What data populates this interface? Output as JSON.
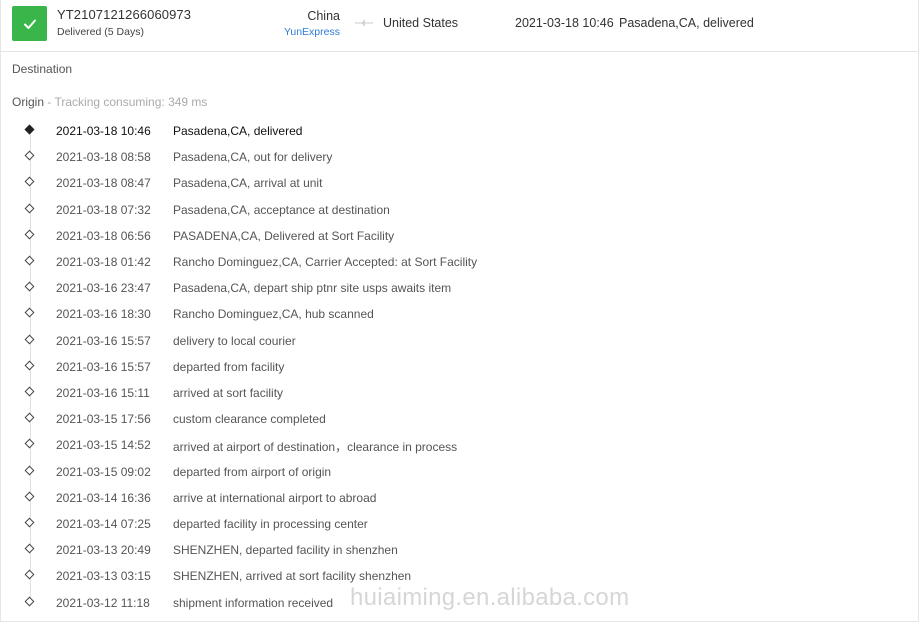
{
  "header": {
    "tracking_number": "YT2107121266060973",
    "status": "Delivered (5 Days)",
    "origin_country": "China",
    "carrier": "YunExpress",
    "destination_country": "United States",
    "latest_time": "2021-03-18 10:46",
    "latest_event": "Pasadena,CA, delivered",
    "status_color": "#39b54a",
    "carrier_color": "#2f7ed8",
    "status_icon": "checkmark-icon",
    "route_icon": "plane-icon"
  },
  "sections": {
    "destination_label": "Destination",
    "origin_label": "Origin",
    "origin_separator": " - ",
    "tracking_consuming": "Tracking consuming: 349 ms"
  },
  "events": [
    {
      "time": "2021-03-18 10:46",
      "desc": "Pasadena,CA, delivered"
    },
    {
      "time": "2021-03-18 08:58",
      "desc": "Pasadena,CA, out for delivery"
    },
    {
      "time": "2021-03-18 08:47",
      "desc": "Pasadena,CA, arrival at unit"
    },
    {
      "time": "2021-03-18 07:32",
      "desc": "Pasadena,CA, acceptance at destination"
    },
    {
      "time": "2021-03-18 06:56",
      "desc": "PASADENA,CA, Delivered at Sort Facility"
    },
    {
      "time": "2021-03-18 01:42",
      "desc": "Rancho Dominguez,CA, Carrier Accepted: at Sort Facility"
    },
    {
      "time": "2021-03-16 23:47",
      "desc": "Pasadena,CA, depart ship ptnr site usps awaits item"
    },
    {
      "time": "2021-03-16 18:30",
      "desc": "Rancho Dominguez,CA, hub scanned"
    },
    {
      "time": "2021-03-16 15:57",
      "desc": "delivery to local courier"
    },
    {
      "time": "2021-03-16 15:57",
      "desc": "departed from facility"
    },
    {
      "time": "2021-03-16 15:11",
      "desc": "arrived at sort facility"
    },
    {
      "time": "2021-03-15 17:56",
      "desc": "custom clearance completed"
    },
    {
      "time": "2021-03-15 14:52",
      "desc": "arrived at airport of destination，clearance in process"
    },
    {
      "time": "2021-03-15 09:02",
      "desc": "departed from airport of origin"
    },
    {
      "time": "2021-03-14 16:36",
      "desc": "arrive at international airport to abroad"
    },
    {
      "time": "2021-03-14 07:25",
      "desc": "departed facility in processing center"
    },
    {
      "time": "2021-03-13 20:49",
      "desc": "SHENZHEN, departed facility in shenzhen"
    },
    {
      "time": "2021-03-13 03:15",
      "desc": "SHENZHEN, arrived at sort facility shenzhen"
    },
    {
      "time": "2021-03-12 11:18",
      "desc": "shipment information received"
    }
  ],
  "watermark": "huiaiming.en.alibaba.com"
}
